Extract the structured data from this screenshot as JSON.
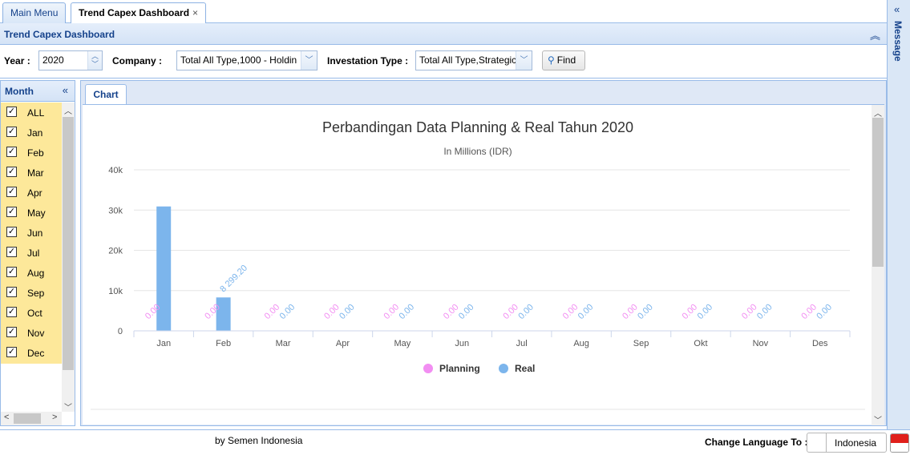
{
  "tabs": [
    {
      "label": "Main Menu",
      "active": false
    },
    {
      "label": "Trend Capex Dashboard",
      "active": true,
      "close": "×"
    }
  ],
  "message_panel": {
    "label": "Message"
  },
  "panel": {
    "title": "Trend Capex Dashboard"
  },
  "filters": {
    "year_label": "Year :",
    "year_value": "2020",
    "company_label": "Company :",
    "company_value": "Total All Type,1000 - Holdin",
    "investation_label": "Investation Type :",
    "investation_value": "Total All Type,Strategic",
    "find_label": "Find"
  },
  "month_panel": {
    "title": "Month",
    "items": [
      {
        "label": "ALL",
        "checked": true
      },
      {
        "label": "Jan",
        "checked": true
      },
      {
        "label": "Feb",
        "checked": true
      },
      {
        "label": "Mar",
        "checked": true
      },
      {
        "label": "Apr",
        "checked": true
      },
      {
        "label": "May",
        "checked": true
      },
      {
        "label": "Jun",
        "checked": true
      },
      {
        "label": "Jul",
        "checked": true
      },
      {
        "label": "Aug",
        "checked": true
      },
      {
        "label": "Sep",
        "checked": true
      },
      {
        "label": "Oct",
        "checked": true
      },
      {
        "label": "Nov",
        "checked": true
      },
      {
        "label": "Dec",
        "checked": true
      }
    ]
  },
  "chart_tab": {
    "label": "Chart"
  },
  "chart_data": {
    "type": "bar",
    "title": "Perbandingan Data Planning & Real Tahun 2020",
    "subtitle": "In Millions (IDR)",
    "categories": [
      "Jan",
      "Feb",
      "Mar",
      "Apr",
      "May",
      "Jun",
      "Jul",
      "Aug",
      "Sep",
      "Okt",
      "Nov",
      "Des"
    ],
    "series": [
      {
        "name": "Planning",
        "color": "#f28ef2",
        "values": [
          0,
          0,
          0,
          0,
          0,
          0,
          0,
          0,
          0,
          0,
          0,
          0
        ],
        "labels": [
          "0.00",
          "0.00",
          "0.00",
          "0.00",
          "0.00",
          "0.00",
          "0.00",
          "0.00",
          "0.00",
          "0.00",
          "0.00",
          "0.00"
        ]
      },
      {
        "name": "Real",
        "color": "#7cb5ec",
        "values": [
          30900,
          8299.2,
          0,
          0,
          0,
          0,
          0,
          0,
          0,
          0,
          0,
          0
        ],
        "labels": [
          "",
          "8 299.20",
          "0.00",
          "0.00",
          "0.00",
          "0.00",
          "0.00",
          "0.00",
          "0.00",
          "0.00",
          "0.00",
          "0.00"
        ]
      }
    ],
    "yticks": [
      "0",
      "10k",
      "20k",
      "30k",
      "40k"
    ],
    "ylim": [
      0,
      40000
    ],
    "grid": true,
    "legend": "bottom"
  },
  "footer": {
    "credit": "by Semen Indonesia",
    "change_language_label": "Change Language To :",
    "language": "Indonesia"
  }
}
